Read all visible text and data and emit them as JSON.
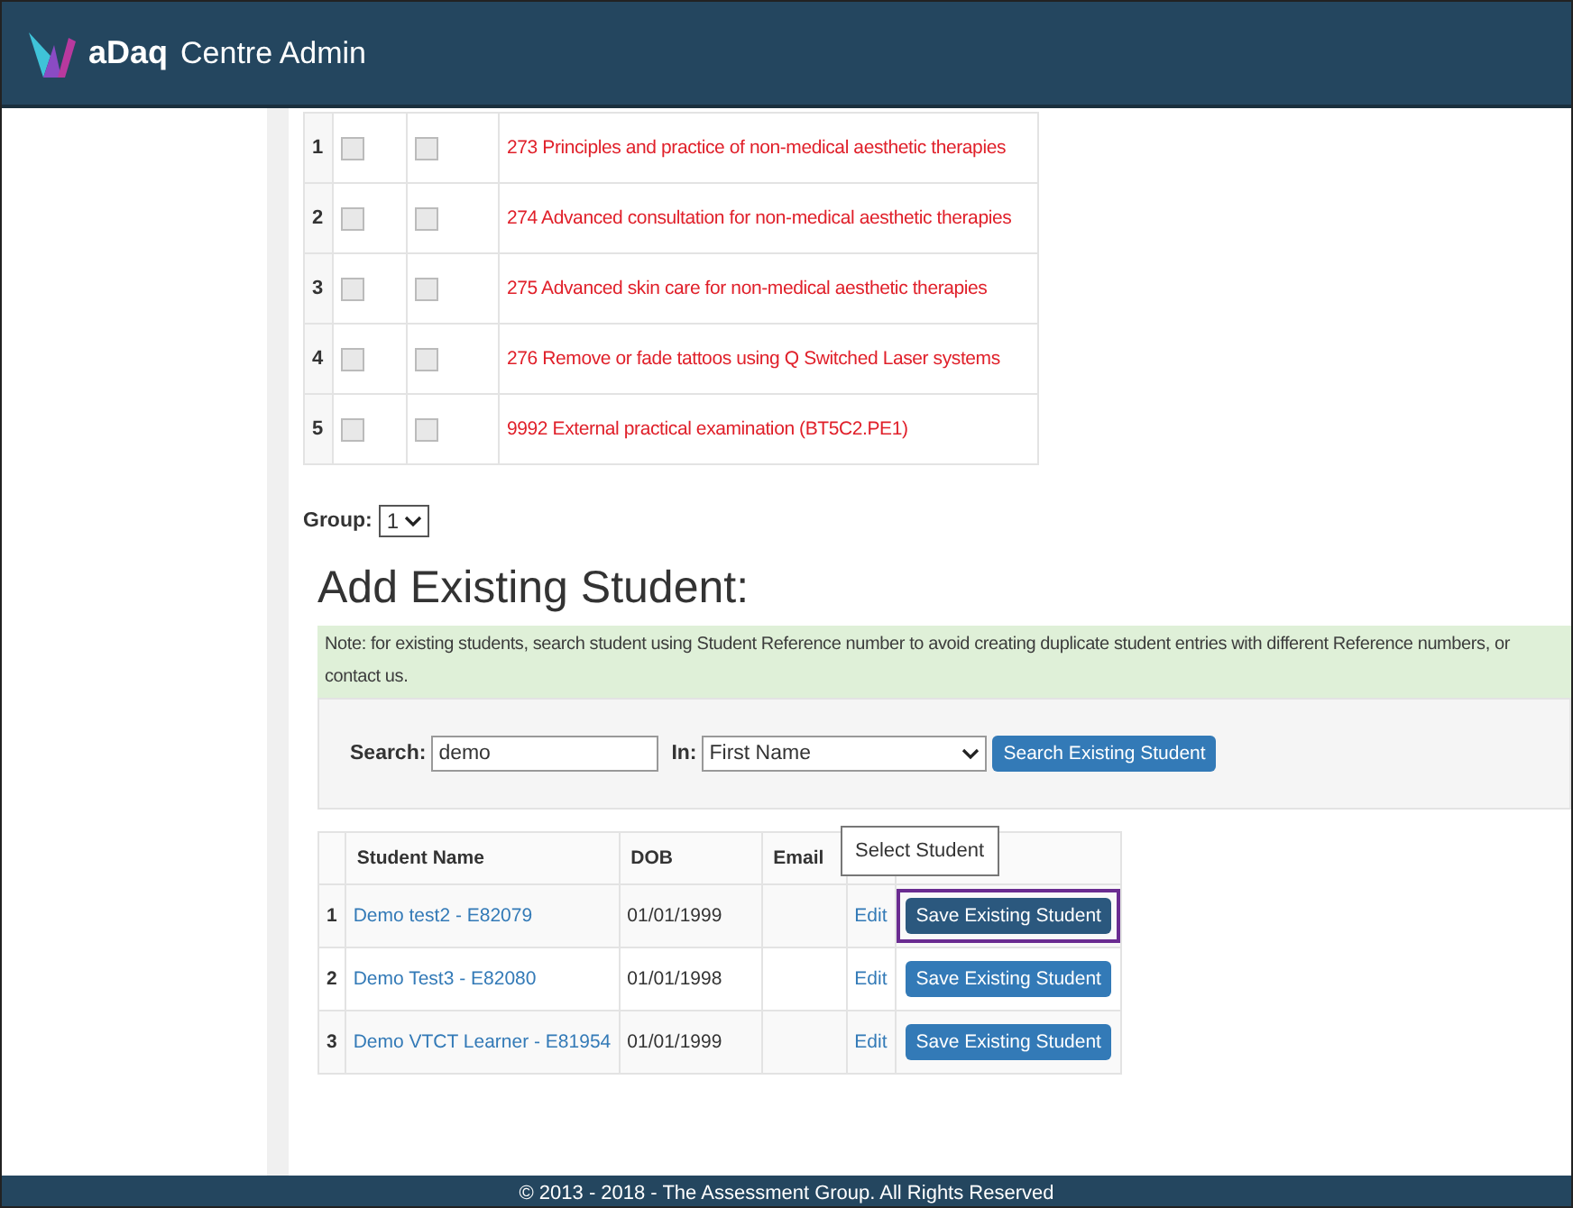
{
  "header": {
    "logo_text": "aDaq",
    "title": "Centre Admin"
  },
  "units": [
    {
      "number": "1",
      "rpl_checked": false,
      "disable_checked": false,
      "title": "273 Principles and practice of non-medical aesthetic therapies"
    },
    {
      "number": "2",
      "rpl_checked": false,
      "disable_checked": false,
      "title": "274 Advanced consultation for non-medical aesthetic therapies"
    },
    {
      "number": "3",
      "rpl_checked": false,
      "disable_checked": false,
      "title": "275 Advanced skin care for non-medical aesthetic therapies"
    },
    {
      "number": "4",
      "rpl_checked": false,
      "disable_checked": false,
      "title": "276 Remove or fade tattoos using Q Switched Laser systems"
    },
    {
      "number": "5",
      "rpl_checked": false,
      "disable_checked": false,
      "title": "9992 External practical examination (BT5C2.PE1)"
    }
  ],
  "group": {
    "label": "Group:",
    "value": "1"
  },
  "heading": "Add Existing Student:",
  "note": "Note: for existing students, search student using Student Reference number to avoid creating duplicate student entries with different Reference numbers, or contact us.",
  "search": {
    "label": "Search:",
    "value": "demo",
    "in_label": "In:",
    "in_value": "First Name",
    "button": "Search Existing Student"
  },
  "students": {
    "columns": [
      "Student Name",
      "DOB",
      "Email"
    ],
    "rows": [
      {
        "number": "1",
        "name": "Demo test2 - E82079",
        "dob": "01/01/1999",
        "edit": "Edit",
        "button": "Save Existing Student",
        "highlighted": true
      },
      {
        "number": "2",
        "name": "Demo Test3 - E82080",
        "dob": "01/01/1998",
        "edit": "Edit",
        "button": "Save Existing Student",
        "highlighted": false
      },
      {
        "number": "3",
        "name": "Demo VTCT Learner - E81954",
        "dob": "01/01/1999",
        "edit": "Edit",
        "button": "Save Existing Student",
        "highlighted": false
      }
    ]
  },
  "tooltip": "Select Student",
  "footer": "© 2013 - 2018 - The Assessment Group. All Rights Reserved"
}
